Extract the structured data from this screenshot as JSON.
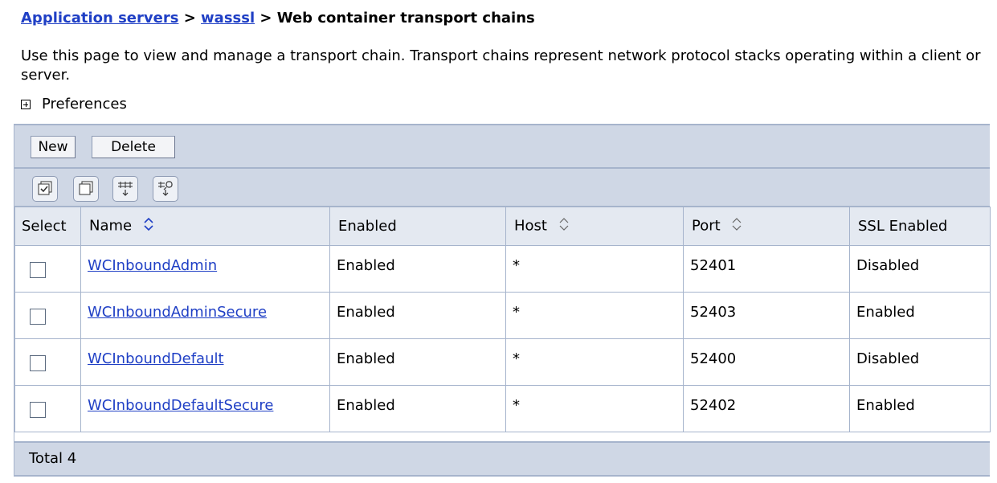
{
  "breadcrumb": {
    "link1": "Application servers",
    "sep1": " > ",
    "link2": "wasssl",
    "sep2": " > ",
    "current": "Web container transport chains"
  },
  "description": "Use this page to view and manage a transport chain. Transport chains represent network protocol stacks operating within a client or server.",
  "preferences": {
    "label": "Preferences",
    "icon": "expand-plus-icon"
  },
  "toolbar": {
    "new_label": "New",
    "delete_label": "Delete"
  },
  "icon_toolbar": [
    {
      "name": "select-all-icon"
    },
    {
      "name": "deselect-all-icon"
    },
    {
      "name": "show-filter-icon"
    },
    {
      "name": "clear-filter-icon"
    }
  ],
  "table": {
    "headers": {
      "select": "Select",
      "name": "Name",
      "enabled": "Enabled",
      "host": "Host",
      "port": "Port",
      "ssl": "SSL Enabled"
    },
    "rows": [
      {
        "name": "WCInboundAdmin",
        "enabled": "Enabled",
        "host": "*",
        "port": "52401",
        "ssl": "Disabled"
      },
      {
        "name": "WCInboundAdminSecure",
        "enabled": "Enabled",
        "host": "*",
        "port": "52403",
        "ssl": "Enabled"
      },
      {
        "name": "WCInboundDefault",
        "enabled": "Enabled",
        "host": "*",
        "port": "52400",
        "ssl": "Disabled"
      },
      {
        "name": "WCInboundDefaultSecure",
        "enabled": "Enabled",
        "host": "*",
        "port": "52402",
        "ssl": "Enabled"
      }
    ]
  },
  "footer": {
    "total": "Total 4"
  },
  "colors": {
    "link": "#1f3fc5",
    "bar": "#cfd7e5",
    "border": "#a6b4cc",
    "header": "#e4e9f1"
  }
}
